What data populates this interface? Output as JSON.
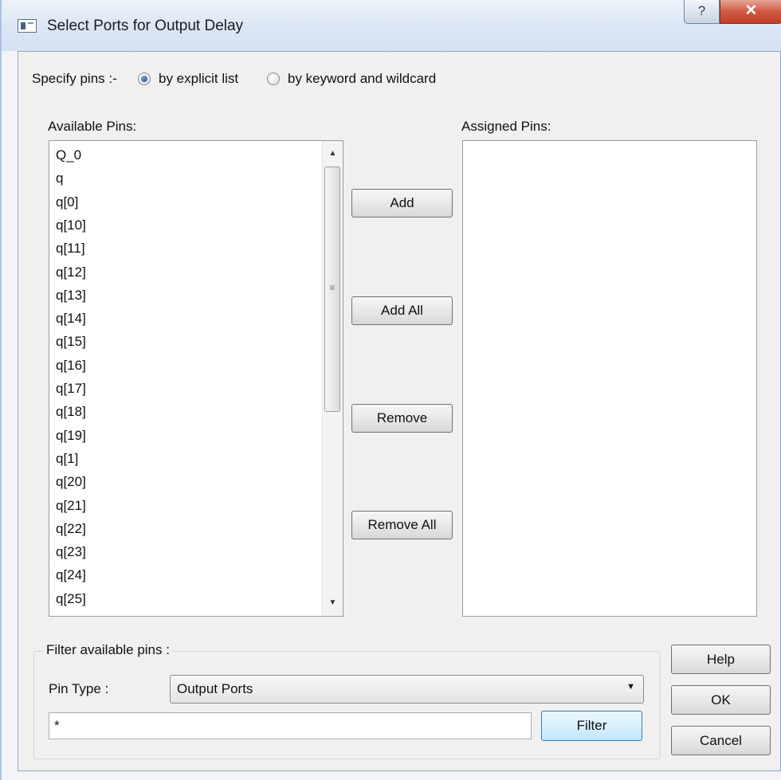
{
  "window": {
    "title": "Select Ports for Output Delay",
    "help_label": "?",
    "close_label": "✕"
  },
  "specify": {
    "label": "Specify pins :-",
    "option_explicit": "by explicit list",
    "option_keyword": "by keyword and wildcard",
    "selected": "by explicit list"
  },
  "available": {
    "label": "Available Pins:",
    "items": [
      "Q_0",
      "q",
      "q[0]",
      "q[10]",
      "q[11]",
      "q[12]",
      "q[13]",
      "q[14]",
      "q[15]",
      "q[16]",
      "q[17]",
      "q[18]",
      "q[19]",
      "q[1]",
      "q[20]",
      "q[21]",
      "q[22]",
      "q[23]",
      "q[24]",
      "q[25]"
    ]
  },
  "assigned": {
    "label": "Assigned Pins:",
    "items": []
  },
  "buttons": {
    "add": "Add",
    "add_all": "Add All",
    "remove": "Remove",
    "remove_all": "Remove All",
    "help": "Help",
    "ok": "OK",
    "cancel": "Cancel",
    "filter": "Filter"
  },
  "filter": {
    "group_label": "Filter available pins :",
    "pin_type_label": "Pin Type :",
    "pin_type_value": "Output Ports",
    "pattern_value": "*"
  },
  "icons": {
    "title": "dialog-window-icon",
    "help": "question-mark-icon",
    "close": "close-x-icon",
    "dropdown": "chevron-down-icon",
    "scroll_up": "scroll-up-arrow-icon",
    "scroll_down": "scroll-down-arrow-icon"
  }
}
